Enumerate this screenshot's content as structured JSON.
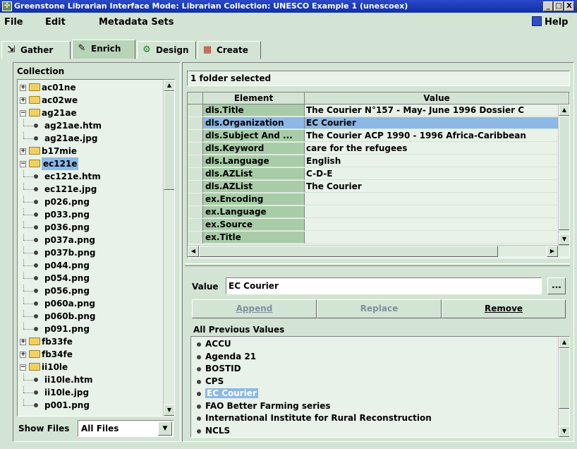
{
  "window": {
    "title": "Greenstone Librarian Interface Mode: Librarian Collection: UNESCO Example 1 (unescoex)",
    "controls": [
      "_",
      "□",
      "X"
    ]
  },
  "menu": {
    "file": "File",
    "edit": "Edit",
    "metadata_sets": "Metadata Sets",
    "help": "Help"
  },
  "tabs": [
    {
      "label": "Gather",
      "icon": "gather-icon"
    },
    {
      "label": "Enrich",
      "icon": "enrich-icon",
      "active": true
    },
    {
      "label": "Design",
      "icon": "design-icon"
    },
    {
      "label": "Create",
      "icon": "create-icon"
    }
  ],
  "collection": {
    "header": "Collection",
    "tree": [
      {
        "label": "ac01ne",
        "type": "folder",
        "expanded": false,
        "depth": 0
      },
      {
        "label": "ac02we",
        "type": "folder",
        "expanded": false,
        "depth": 0
      },
      {
        "label": "ag21ae",
        "type": "folder",
        "expanded": true,
        "depth": 0
      },
      {
        "label": "ag21ae.htm",
        "type": "file",
        "depth": 1
      },
      {
        "label": "ag21ae.jpg",
        "type": "file",
        "depth": 1
      },
      {
        "label": "b17mie",
        "type": "folder",
        "expanded": false,
        "depth": 0
      },
      {
        "label": "ec121e",
        "type": "folder",
        "expanded": true,
        "depth": 0,
        "selected": true
      },
      {
        "label": "ec121e.htm",
        "type": "file",
        "depth": 1
      },
      {
        "label": "ec121e.jpg",
        "type": "file",
        "depth": 1
      },
      {
        "label": "p026.png",
        "type": "file",
        "depth": 1
      },
      {
        "label": "p033.png",
        "type": "file",
        "depth": 1
      },
      {
        "label": "p036.png",
        "type": "file",
        "depth": 1
      },
      {
        "label": "p037a.png",
        "type": "file",
        "depth": 1
      },
      {
        "label": "p037b.png",
        "type": "file",
        "depth": 1
      },
      {
        "label": "p044.png",
        "type": "file",
        "depth": 1
      },
      {
        "label": "p054.png",
        "type": "file",
        "depth": 1
      },
      {
        "label": "p056.png",
        "type": "file",
        "depth": 1
      },
      {
        "label": "p060a.png",
        "type": "file",
        "depth": 1
      },
      {
        "label": "p060b.png",
        "type": "file",
        "depth": 1
      },
      {
        "label": "p091.png",
        "type": "file",
        "depth": 1
      },
      {
        "label": "fb33fe",
        "type": "folder",
        "expanded": false,
        "depth": 0
      },
      {
        "label": "fb34fe",
        "type": "folder",
        "expanded": false,
        "depth": 0
      },
      {
        "label": "ii10le",
        "type": "folder",
        "expanded": true,
        "depth": 0
      },
      {
        "label": "ii10le.htm",
        "type": "file",
        "depth": 1
      },
      {
        "label": "ii10le.jpg",
        "type": "file",
        "depth": 1
      },
      {
        "label": "p001.png",
        "type": "file",
        "depth": 1
      }
    ],
    "show_files_label": "Show Files",
    "show_files_value": "All Files"
  },
  "metadata": {
    "selection_status": "1 folder selected",
    "columns": [
      "Element",
      "Value"
    ],
    "rows": [
      {
        "element": "dls.Title",
        "value": "The Courier N°157 - May- June 1996 Dossier C"
      },
      {
        "element": "dls.Organization",
        "value": "EC Courier",
        "selected": true
      },
      {
        "element": "dls.Subject And ...",
        "value": "The Courier ACP 1990 - 1996 Africa-Caribbean"
      },
      {
        "element": "dls.Keyword",
        "value": "care for the refugees"
      },
      {
        "element": "dls.Language",
        "value": "English"
      },
      {
        "element": "dls.AZList",
        "value": "C-D-E"
      },
      {
        "element": "dls.AZList",
        "value": "The Courier"
      },
      {
        "element": "ex.Encoding",
        "value": ""
      },
      {
        "element": "ex.Language",
        "value": ""
      },
      {
        "element": "ex.Source",
        "value": ""
      },
      {
        "element": "ex.Title",
        "value": ""
      }
    ]
  },
  "editor": {
    "value_label": "Value",
    "value": "EC Courier",
    "ellipsis": "...",
    "append": "Append",
    "replace": "Replace",
    "remove": "Remove",
    "previous_values_label": "All Previous Values",
    "previous_values": [
      "ACCU",
      "Agenda 21",
      "BOSTID",
      "CPS",
      "EC Courier",
      "FAO Better Farming series",
      "International Institute for Rural Reconstruction",
      "NCLS"
    ],
    "previous_selected_index": 4
  },
  "colors": {
    "background": "#d4e4d4",
    "selection": "#8cb8e8",
    "title_bar": "#1030a8",
    "element_cell": "#a8cca8"
  }
}
